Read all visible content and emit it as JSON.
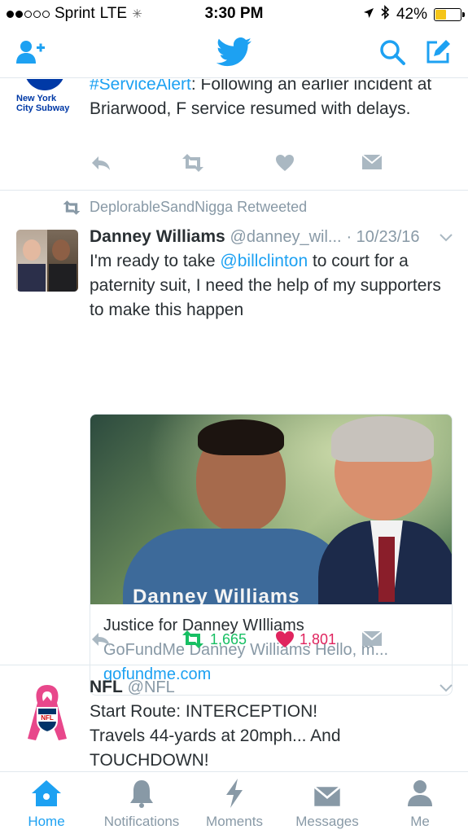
{
  "status_bar": {
    "carrier": "Sprint",
    "network": "LTE",
    "time": "3:30 PM",
    "battery": "42%",
    "signal_bars_filled": 2,
    "signal_bars_total": 5,
    "battery_level": 0.42
  },
  "nav": {
    "add_user_icon": "add-user-icon",
    "logo_icon": "twitter-bird-icon",
    "search_icon": "search-icon",
    "compose_icon": "compose-icon"
  },
  "tweets": [
    {
      "avatar_text": "New York City Subway",
      "text_link": "#ServiceAlert",
      "text_rest": ": Following an earlier incident at Briarwood, F service resumed with delays.",
      "retweets": "",
      "likes": ""
    },
    {
      "retweeted_by": "DeplorableSandNigga Retweeted",
      "name": "Danney Williams",
      "handle": "@danney_wil...",
      "date": "· 10/23/16",
      "text_before": "I'm ready to take ",
      "mention": "@billclinton",
      "text_after": " to court for a paternity suit, I need the help of my supporters to make this happen",
      "card": {
        "image_caption": "Danney Williams",
        "title": "Justice for Danney WIlliams",
        "description": "GoFundMe Danney Williams Hello, m...",
        "domain": "gofundme.com"
      },
      "retweets": "1,665",
      "likes": "1,801"
    },
    {
      "name": "NFL",
      "handle": "@NFL",
      "avatar_text": "NFL",
      "text": "Start Route: INTERCEPTION! Travels 44-yards at 20mph... And TOUCHDOWN!"
    }
  ],
  "tabs": [
    {
      "label": "Home",
      "icon": "home-icon"
    },
    {
      "label": "Notifications",
      "icon": "bell-icon"
    },
    {
      "label": "Moments",
      "icon": "lightning-icon"
    },
    {
      "label": "Messages",
      "icon": "envelope-icon"
    },
    {
      "label": "Me",
      "icon": "person-icon"
    }
  ],
  "colors": {
    "accent": "#1da1f2",
    "retweet_green": "#17bf63",
    "like_red": "#e0245e",
    "muted": "#8899a6"
  }
}
